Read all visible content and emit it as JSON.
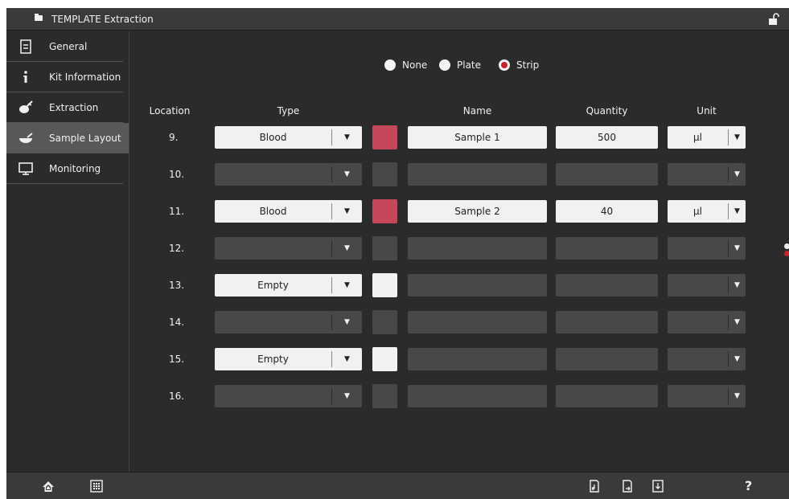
{
  "window": {
    "title": "TEMPLATE Extraction"
  },
  "sidebar": {
    "items": [
      {
        "label": "General",
        "icon": "document-icon"
      },
      {
        "label": "Kit Information",
        "icon": "info-icon"
      },
      {
        "label": "Extraction",
        "icon": "extraction-icon"
      },
      {
        "label": "Sample Layout",
        "icon": "bowl-icon",
        "active": true
      },
      {
        "label": "Monitoring",
        "icon": "monitor-icon"
      }
    ]
  },
  "layout_mode": {
    "options": [
      "None",
      "Plate",
      "Strip"
    ],
    "selected": "Strip"
  },
  "columns": {
    "location": "Location",
    "type": "Type",
    "name": "Name",
    "quantity": "Quantity",
    "unit": "Unit"
  },
  "rows": [
    {
      "location": "9.",
      "type": "Blood",
      "color": "#c5475c",
      "name": "Sample 1",
      "quantity": "500",
      "unit": "µl"
    },
    {
      "location": "10.",
      "type": "",
      "color": "",
      "name": "",
      "quantity": "",
      "unit": ""
    },
    {
      "location": "11.",
      "type": "Blood",
      "color": "#c5475c",
      "name": "Sample 2",
      "quantity": "40",
      "unit": "µl"
    },
    {
      "location": "12.",
      "type": "",
      "color": "",
      "name": "",
      "quantity": "",
      "unit": ""
    },
    {
      "location": "13.",
      "type": "Empty",
      "color": "#f2f2f2",
      "name": "",
      "quantity": "",
      "unit": ""
    },
    {
      "location": "14.",
      "type": "",
      "color": "",
      "name": "",
      "quantity": "",
      "unit": ""
    },
    {
      "location": "15.",
      "type": "Empty",
      "color": "#f2f2f2",
      "name": "",
      "quantity": "",
      "unit": ""
    },
    {
      "location": "16.",
      "type": "",
      "color": "",
      "name": "",
      "quantity": "",
      "unit": ""
    }
  ],
  "bottombar": {
    "left_icons": [
      "home-icon",
      "grid-icon"
    ],
    "right_icons": [
      "import-icon",
      "export-icon",
      "save-icon"
    ],
    "help_label": "?"
  },
  "colors": {
    "background": "#2b2b2b",
    "bar": "#3a3a3a",
    "active_nav": "#585858",
    "accent_red": "#c7242e",
    "sample_swatch": "#c5475c"
  }
}
